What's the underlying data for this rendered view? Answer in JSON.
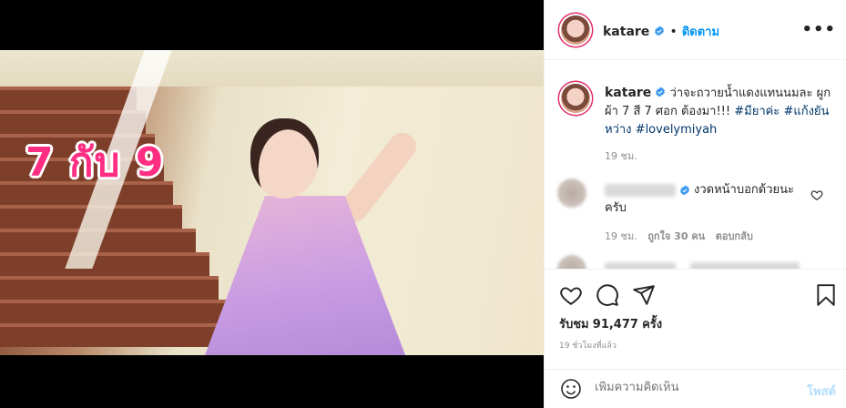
{
  "video": {
    "overlay_text": "7 กับ 9"
  },
  "post": {
    "username": "katare",
    "follow_separator": "•",
    "follow_label": "ติดตาม",
    "more_label": "•••",
    "caption_user": "katare",
    "caption_text": "ว่าจะถวายน้ำแดงแทนนมละ ผูกผ้า 7 สี 7 ศอก ต้องมา!!!",
    "hashtags": [
      "#มียาค่ะ",
      "#แก้งยันหว่าง",
      "#lovelymiyah"
    ],
    "caption_time": "19 ชม."
  },
  "comments": [
    {
      "text": "งวดหน้าบอกด้วยนะครับ",
      "time": "19 ชม.",
      "likes": "ถูกใจ 30 คน",
      "reply": "ตอบกลับ"
    }
  ],
  "actions": {
    "views_label": "รับชม",
    "views_count": "91,477",
    "views_suffix": "ครั้ง",
    "ago": "19 ชั่วโมงที่แล้ว"
  },
  "comment_box": {
    "placeholder": "เพิ่มความคิดเห็น",
    "post_label": "โพสต์"
  },
  "colors": {
    "accent": "#0095f6",
    "hashtag": "#00376b",
    "muted": "#8e8e8e",
    "overlay_pink": "#ff2e83"
  }
}
